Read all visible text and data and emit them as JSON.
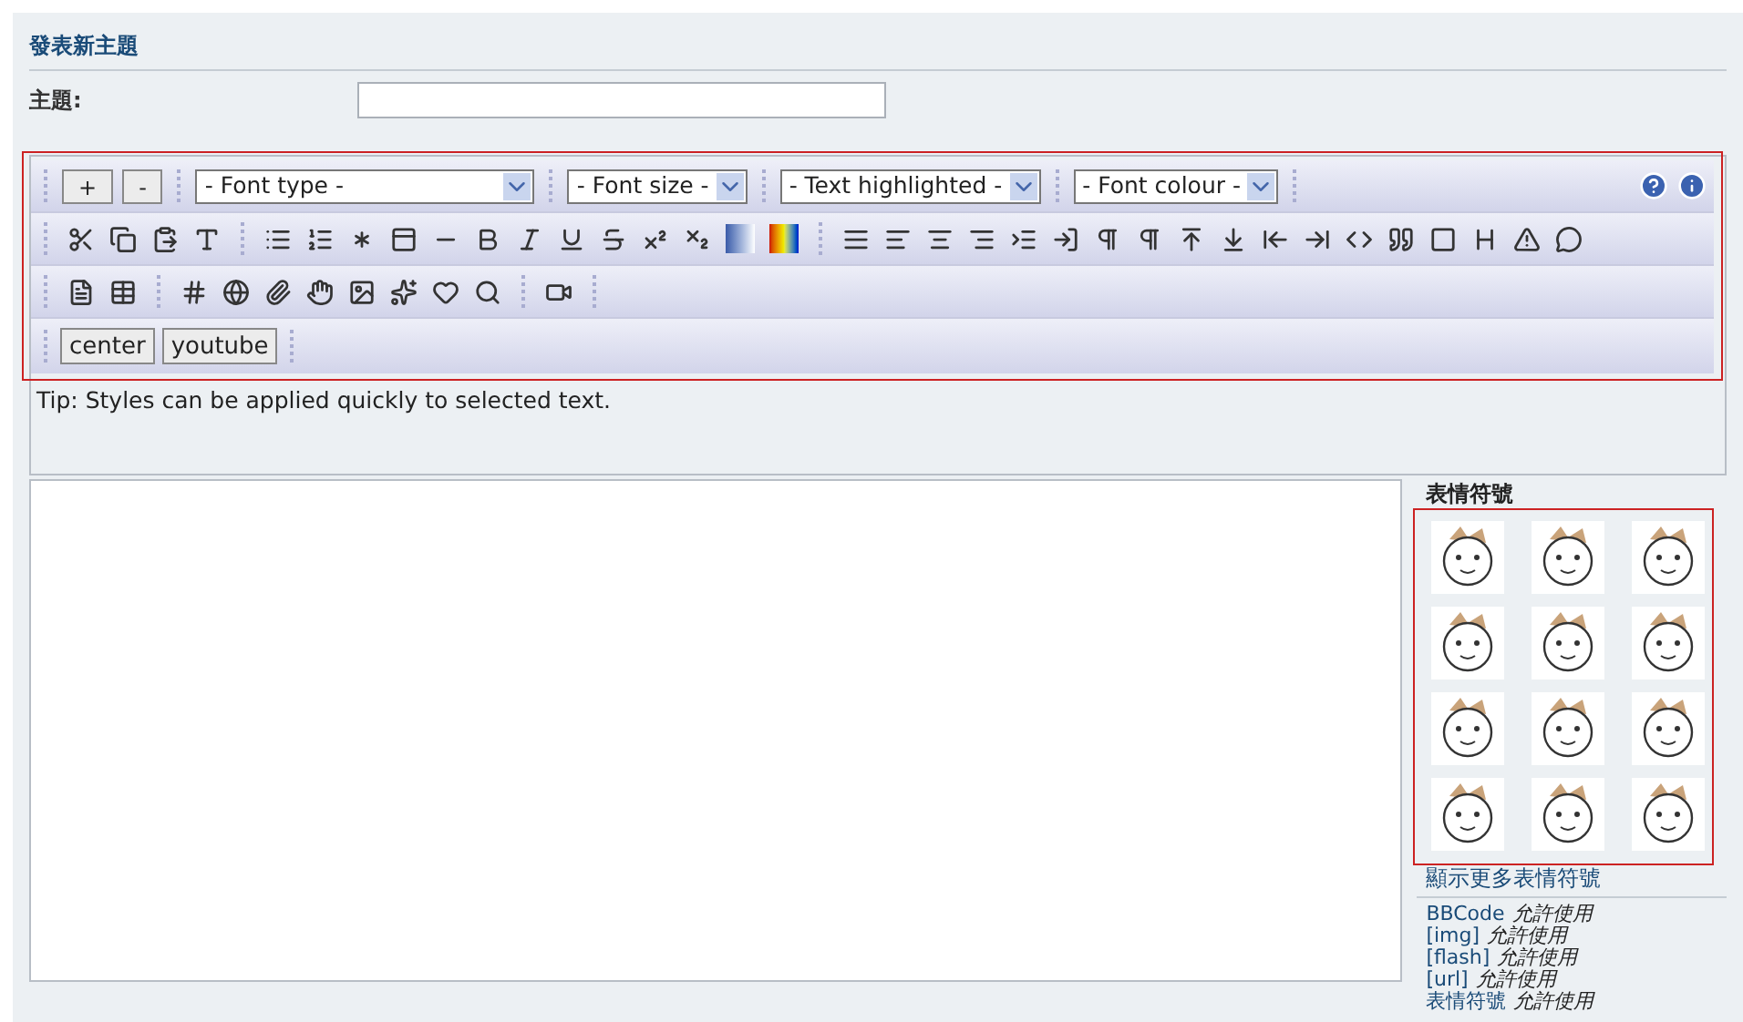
{
  "page_title": "發表新主題",
  "subject": {
    "label": "主題:"
  },
  "editor": {
    "size_buttons": [
      "+",
      "-"
    ],
    "selects": [
      "- Font type -",
      "- Font size -",
      "- Text highlighted -",
      "- Font colour -"
    ],
    "custom_buttons": [
      "center",
      "youtube"
    ],
    "tip": "Tip: Styles can be applied quickly to selected text."
  },
  "smilies": {
    "title": "表情符號",
    "more_link": "顯示更多表情符號"
  },
  "permissions": [
    {
      "tag": "BBCode",
      "status": "允許使用"
    },
    {
      "tag": "[img]",
      "status": "允許使用"
    },
    {
      "tag": "[flash]",
      "status": "允許使用"
    },
    {
      "tag": "[url]",
      "status": "允許使用"
    },
    {
      "tag": "表情符號",
      "status": "允許使用"
    }
  ]
}
